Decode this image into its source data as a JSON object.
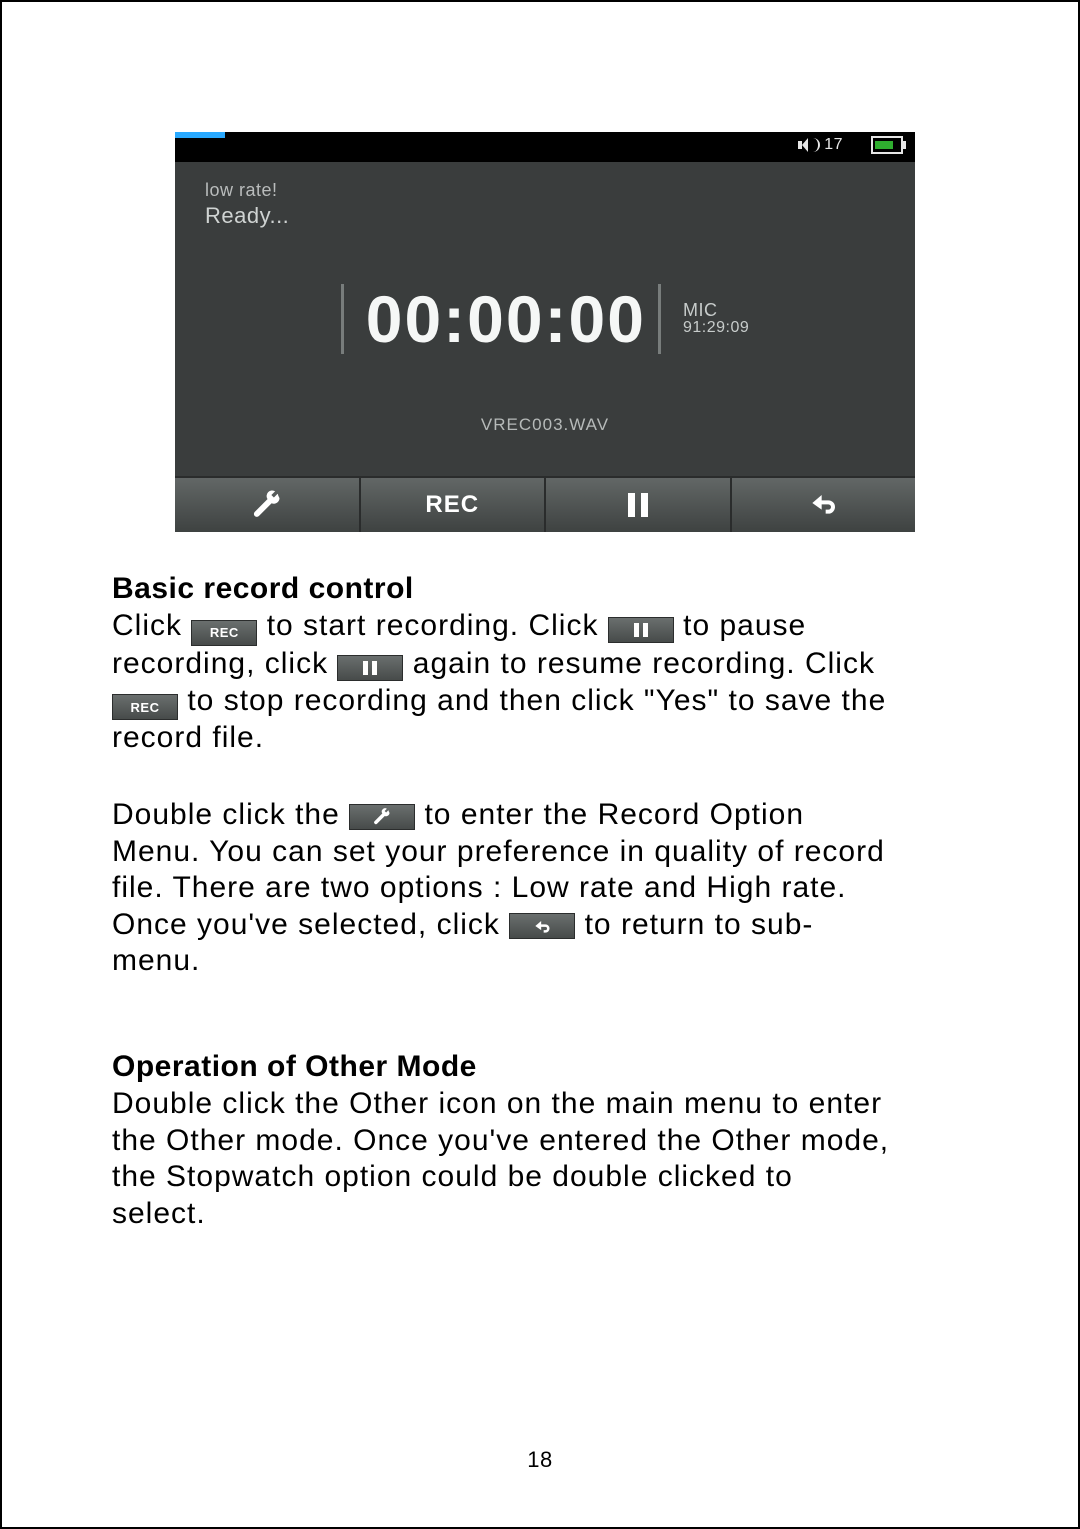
{
  "device": {
    "top": {
      "volume": "17"
    },
    "rate_line": "low rate!",
    "ready_line": "Ready...",
    "timer_main": "00:00:00",
    "timer_mic_label": "MIC",
    "timer_remaining": "91:29:09",
    "filename": "VREC003.WAV",
    "buttons": {
      "rec": "REC"
    }
  },
  "sections": {
    "basic_title": "Basic record control",
    "basic": {
      "t1a": "Click",
      "t1b": "to start recording. Click ",
      "t1c": " to pause",
      "t2a": "recording, click",
      "t2b": "again to resume recording. Click",
      "t3a": "to stop recording and then click \"Yes\" to save the",
      "t4": "record file.",
      "t5a": "Double click the",
      "t5b": "to enter the Record Option",
      "t6": "Menu. You can set your preference in quality of record",
      "t7": "file. There are two options : Low rate and High rate.",
      "t8a": "Once you've selected, click",
      "t8b": " to return to sub-",
      "t9": "menu."
    },
    "other_title": "Operation of Other Mode",
    "other": {
      "t1": "Double click the Other icon on the main menu to enter",
      "t2": "the Other mode. Once you've entered the Other mode,",
      "t3": "the Stopwatch option could be double clicked to",
      "t4": "select."
    }
  },
  "page_number": "18",
  "inline_labels": {
    "rec": "REC"
  }
}
